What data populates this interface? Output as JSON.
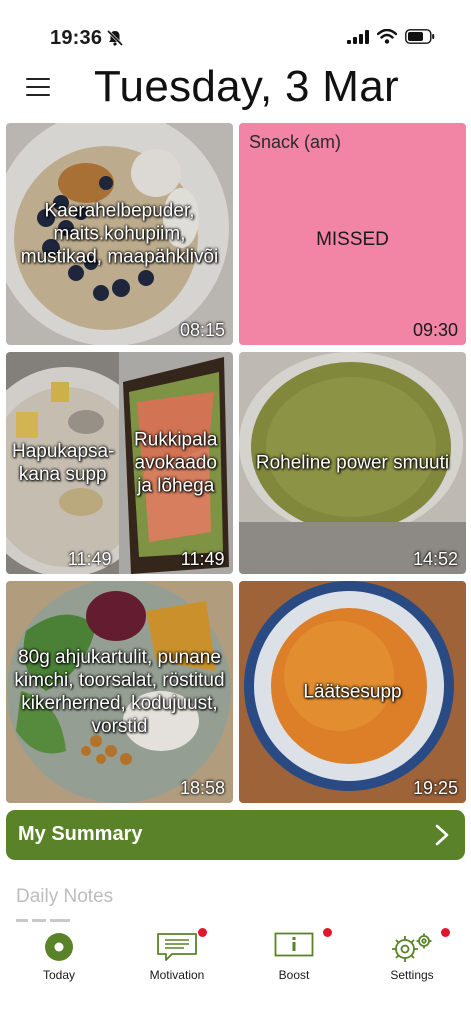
{
  "status": {
    "time": "19:36"
  },
  "header": {
    "title": "Tuesday, 3 Mar"
  },
  "meals": [
    {
      "label": "Kaerahelbepuder, maits.kohupiim, mustikad, maapähklivõi",
      "time": "08:15"
    },
    {
      "slot": "Snack (am)",
      "status": "MISSED",
      "time": "09:30"
    },
    {
      "label": "Hapukapsa-kana supp",
      "time": "11:49"
    },
    {
      "label": "Rukkipala avokaado ja lõhega",
      "time": "11:49"
    },
    {
      "label": "Roheline power smuuti",
      "time": "14:52"
    },
    {
      "label": "80g ahjukartulit, punane kimchi, toorsalat, röstitud kikerherned, kodujuust, vorstid",
      "time": "18:58"
    },
    {
      "label": "Läätsesupp",
      "time": "19:25"
    }
  ],
  "summary": {
    "label": "My Summary"
  },
  "notes": {
    "title": "Daily Notes"
  },
  "tabs": [
    {
      "label": "Today"
    },
    {
      "label": "Motivation"
    },
    {
      "label": "Boost"
    },
    {
      "label": "Settings"
    }
  ],
  "colors": {
    "accent": "#5a8329",
    "missed": "#f285a6",
    "badge": "#e0162b"
  }
}
